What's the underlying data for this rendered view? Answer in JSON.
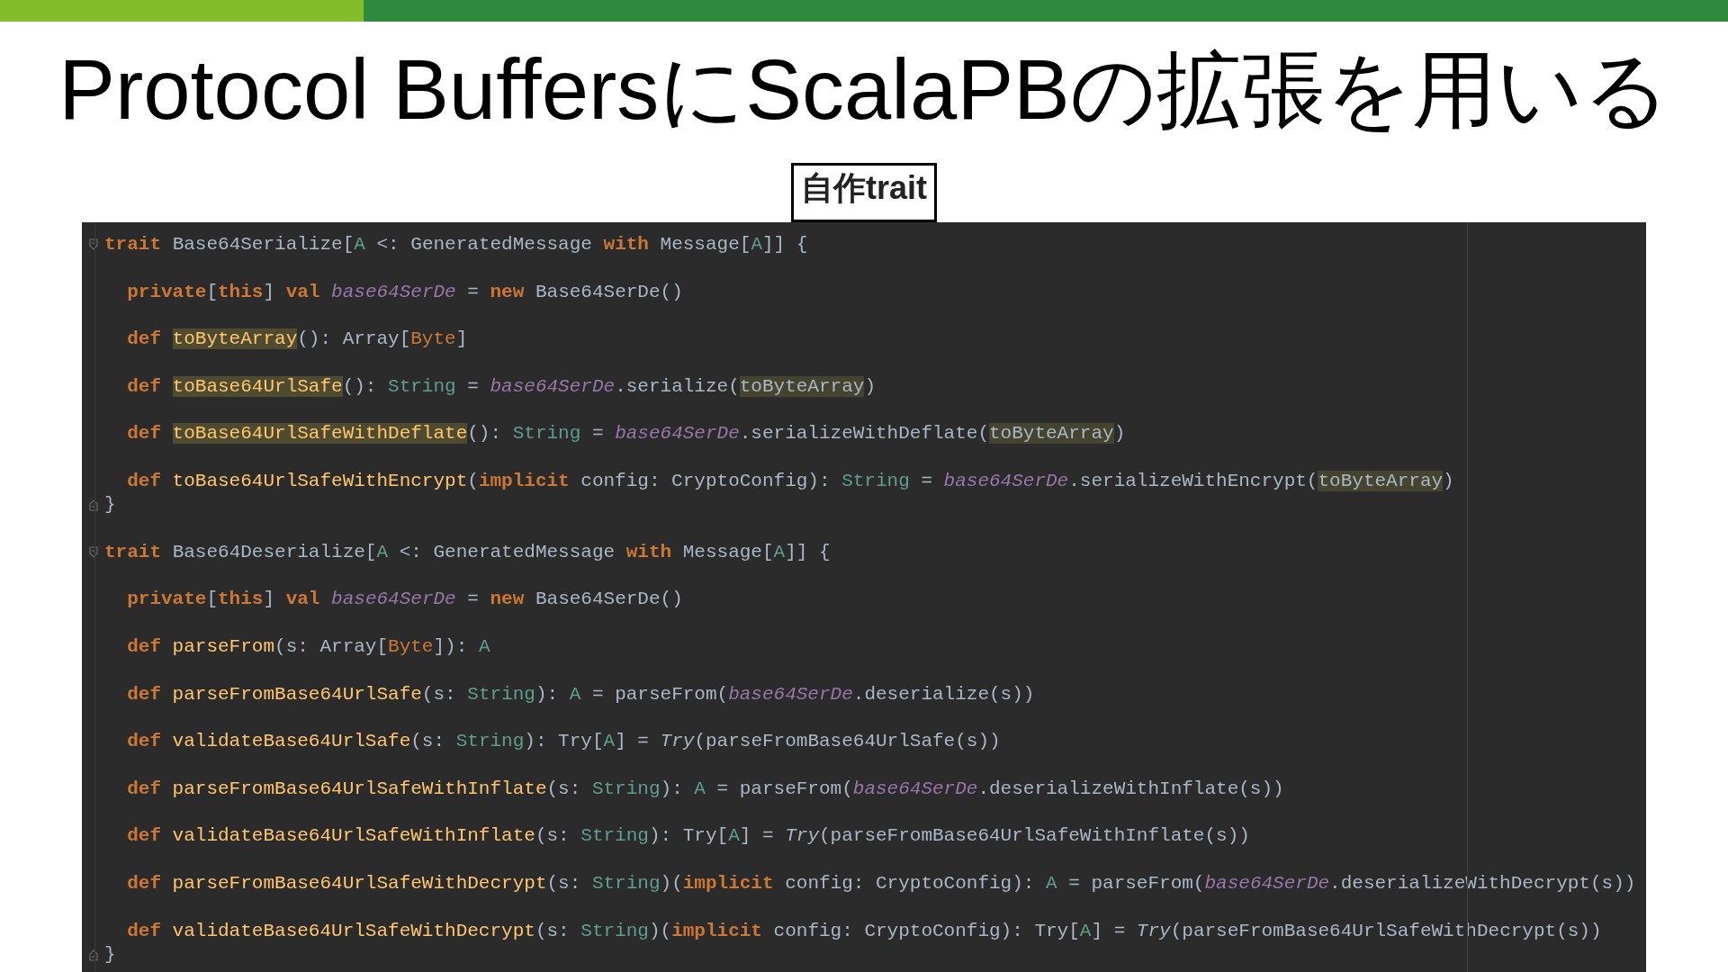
{
  "title": "Protocol BuffersにScalaPBの拡張を用いる",
  "label": "自作trait",
  "code_blocks": [
    {
      "header": [
        {
          "text": "trait ",
          "kind": "keyword"
        },
        {
          "text": "Base64Serialize[",
          "kind": "plain"
        },
        {
          "text": "A",
          "kind": "type"
        },
        {
          "text": " <: GeneratedMessage ",
          "kind": "plain"
        },
        {
          "text": "with",
          "kind": "keyword"
        },
        {
          "text": " Message[",
          "kind": "plain"
        },
        {
          "text": "A",
          "kind": "type"
        },
        {
          "text": "]] {",
          "kind": "plain"
        }
      ],
      "members": [
        [
          {
            "text": "private",
            "kind": "keyword"
          },
          {
            "text": "[",
            "kind": "plain"
          },
          {
            "text": "this",
            "kind": "keyword"
          },
          {
            "text": "] ",
            "kind": "plain"
          },
          {
            "text": "val ",
            "kind": "keyword"
          },
          {
            "text": "base64SerDe",
            "kind": "field"
          },
          {
            "text": " = ",
            "kind": "plain"
          },
          {
            "text": "new",
            "kind": "keyword"
          },
          {
            "text": " Base64SerDe()",
            "kind": "plain"
          }
        ],
        [
          {
            "text": "def ",
            "kind": "keyword"
          },
          {
            "text": "toByteArray",
            "kind": "name_hl"
          },
          {
            "text": "(): Array[",
            "kind": "plain"
          },
          {
            "text": "Byte",
            "kind": "orange"
          },
          {
            "text": "]",
            "kind": "plain"
          }
        ],
        [
          {
            "text": "def ",
            "kind": "keyword"
          },
          {
            "text": "toBase64UrlSafe",
            "kind": "name_hl"
          },
          {
            "text": "(): ",
            "kind": "plain"
          },
          {
            "text": "String",
            "kind": "type"
          },
          {
            "text": " = ",
            "kind": "plain"
          },
          {
            "text": "base64SerDe",
            "kind": "field"
          },
          {
            "text": ".serialize(",
            "kind": "plain"
          },
          {
            "text": "toByteArray",
            "kind": "usage_hl"
          },
          {
            "text": ")",
            "kind": "plain"
          }
        ],
        [
          {
            "text": "def ",
            "kind": "keyword"
          },
          {
            "text": "toBase64UrlSafeWithDeflate",
            "kind": "name_hl"
          },
          {
            "text": "(): ",
            "kind": "plain"
          },
          {
            "text": "String",
            "kind": "type"
          },
          {
            "text": " = ",
            "kind": "plain"
          },
          {
            "text": "base64SerDe",
            "kind": "field"
          },
          {
            "text": ".serializeWithDeflate(",
            "kind": "plain"
          },
          {
            "text": "toByteArray",
            "kind": "usage_hl"
          },
          {
            "text": ")",
            "kind": "plain"
          }
        ],
        [
          {
            "text": "def ",
            "kind": "keyword"
          },
          {
            "text": "toBase64UrlSafeWithEncrypt",
            "kind": "name"
          },
          {
            "text": "(",
            "kind": "plain"
          },
          {
            "text": "implicit",
            "kind": "keyword"
          },
          {
            "text": " config: CryptoConfig): ",
            "kind": "plain"
          },
          {
            "text": "String",
            "kind": "type"
          },
          {
            "text": " = ",
            "kind": "plain"
          },
          {
            "text": "base64SerDe",
            "kind": "field"
          },
          {
            "text": ".serializeWithEncrypt(",
            "kind": "plain"
          },
          {
            "text": "toByteArray",
            "kind": "usage_hl"
          },
          {
            "text": ")",
            "kind": "plain"
          }
        ]
      ],
      "close": "}"
    },
    {
      "header": [
        {
          "text": "trait ",
          "kind": "keyword"
        },
        {
          "text": "Base64Deserialize[",
          "kind": "plain"
        },
        {
          "text": "A",
          "kind": "type"
        },
        {
          "text": " <: GeneratedMessage ",
          "kind": "plain"
        },
        {
          "text": "with",
          "kind": "keyword"
        },
        {
          "text": " Message[",
          "kind": "plain"
        },
        {
          "text": "A",
          "kind": "type"
        },
        {
          "text": "]] {",
          "kind": "plain"
        }
      ],
      "members": [
        [
          {
            "text": "private",
            "kind": "keyword"
          },
          {
            "text": "[",
            "kind": "plain"
          },
          {
            "text": "this",
            "kind": "keyword"
          },
          {
            "text": "] ",
            "kind": "plain"
          },
          {
            "text": "val ",
            "kind": "keyword"
          },
          {
            "text": "base64SerDe",
            "kind": "field"
          },
          {
            "text": " = ",
            "kind": "plain"
          },
          {
            "text": "new",
            "kind": "keyword"
          },
          {
            "text": " Base64SerDe()",
            "kind": "plain"
          }
        ],
        [
          {
            "text": "def ",
            "kind": "keyword"
          },
          {
            "text": "parseFrom",
            "kind": "name"
          },
          {
            "text": "(s: Array[",
            "kind": "plain"
          },
          {
            "text": "Byte",
            "kind": "orange"
          },
          {
            "text": "]): ",
            "kind": "plain"
          },
          {
            "text": "A",
            "kind": "type"
          }
        ],
        [
          {
            "text": "def ",
            "kind": "keyword"
          },
          {
            "text": "parseFromBase64UrlSafe",
            "kind": "name"
          },
          {
            "text": "(s: ",
            "kind": "plain"
          },
          {
            "text": "String",
            "kind": "type"
          },
          {
            "text": "): ",
            "kind": "plain"
          },
          {
            "text": "A",
            "kind": "type"
          },
          {
            "text": " = parseFrom(",
            "kind": "plain"
          },
          {
            "text": "base64SerDe",
            "kind": "field"
          },
          {
            "text": ".deserialize(s))",
            "kind": "plain"
          }
        ],
        [
          {
            "text": "def ",
            "kind": "keyword"
          },
          {
            "text": "validateBase64UrlSafe",
            "kind": "name"
          },
          {
            "text": "(s: ",
            "kind": "plain"
          },
          {
            "text": "String",
            "kind": "type"
          },
          {
            "text": "): Try[",
            "kind": "plain"
          },
          {
            "text": "A",
            "kind": "type"
          },
          {
            "text": "] = ",
            "kind": "plain"
          },
          {
            "text": "Try",
            "kind": "italic"
          },
          {
            "text": "(parseFromBase64UrlSafe(s))",
            "kind": "plain"
          }
        ],
        [
          {
            "text": "def ",
            "kind": "keyword"
          },
          {
            "text": "parseFromBase64UrlSafeWithInflate",
            "kind": "name"
          },
          {
            "text": "(s: ",
            "kind": "plain"
          },
          {
            "text": "String",
            "kind": "type"
          },
          {
            "text": "): ",
            "kind": "plain"
          },
          {
            "text": "A",
            "kind": "type"
          },
          {
            "text": " = parseFrom(",
            "kind": "plain"
          },
          {
            "text": "base64SerDe",
            "kind": "field"
          },
          {
            "text": ".deserializeWithInflate(s))",
            "kind": "plain"
          }
        ],
        [
          {
            "text": "def ",
            "kind": "keyword"
          },
          {
            "text": "validateBase64UrlSafeWithInflate",
            "kind": "name"
          },
          {
            "text": "(s: ",
            "kind": "plain"
          },
          {
            "text": "String",
            "kind": "type"
          },
          {
            "text": "): Try[",
            "kind": "plain"
          },
          {
            "text": "A",
            "kind": "type"
          },
          {
            "text": "] = ",
            "kind": "plain"
          },
          {
            "text": "Try",
            "kind": "italic"
          },
          {
            "text": "(parseFromBase64UrlSafeWithInflate(s))",
            "kind": "plain"
          }
        ],
        [
          {
            "text": "def ",
            "kind": "keyword"
          },
          {
            "text": "parseFromBase64UrlSafeWithDecrypt",
            "kind": "name"
          },
          {
            "text": "(s: ",
            "kind": "plain"
          },
          {
            "text": "String",
            "kind": "type"
          },
          {
            "text": ")(",
            "kind": "plain"
          },
          {
            "text": "implicit",
            "kind": "keyword"
          },
          {
            "text": " config: CryptoConfig): ",
            "kind": "plain"
          },
          {
            "text": "A",
            "kind": "type"
          },
          {
            "text": " = parseFrom(",
            "kind": "plain"
          },
          {
            "text": "base64SerDe",
            "kind": "field"
          },
          {
            "text": ".deserializeWithDecrypt(s))",
            "kind": "plain"
          }
        ],
        [
          {
            "text": "def ",
            "kind": "keyword"
          },
          {
            "text": "validateBase64UrlSafeWithDecrypt",
            "kind": "name"
          },
          {
            "text": "(s: ",
            "kind": "plain"
          },
          {
            "text": "String",
            "kind": "type"
          },
          {
            "text": ")(",
            "kind": "plain"
          },
          {
            "text": "implicit",
            "kind": "keyword"
          },
          {
            "text": " config: CryptoConfig): Try[",
            "kind": "plain"
          },
          {
            "text": "A",
            "kind": "type"
          },
          {
            "text": "] = ",
            "kind": "plain"
          },
          {
            "text": "Try",
            "kind": "italic"
          },
          {
            "text": "(parseFromBase64UrlSafeWithDecrypt(s))",
            "kind": "plain"
          }
        ]
      ],
      "close": "}"
    }
  ]
}
